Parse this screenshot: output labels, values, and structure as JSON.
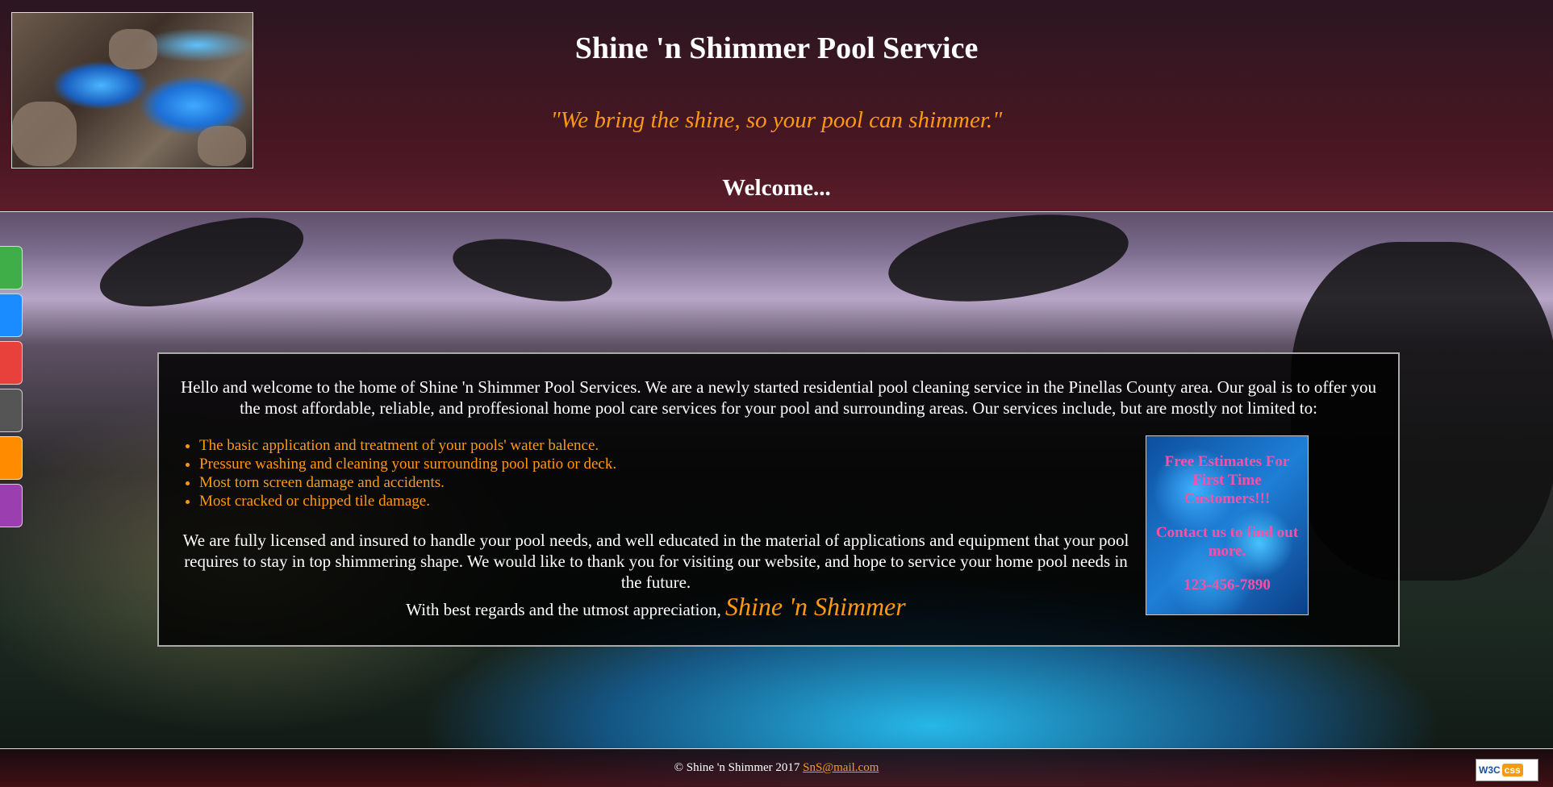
{
  "header": {
    "title": "Shine 'n Shimmer Pool Service",
    "tagline": "\"We bring the shine, so your pool can shimmer.\"",
    "welcome": "Welcome..."
  },
  "side_nav": {
    "colors": [
      "#3fae49",
      "#1a8cff",
      "#e8413c",
      "#555555",
      "#ff8c00",
      "#9b3fb0"
    ]
  },
  "main": {
    "intro": "Hello and welcome to the home of Shine 'n Shimmer Pool Services. We are a newly started residential pool cleaning service in the Pinellas County area. Our goal is to offer you the most affordable, reliable, and proffesional home pool care services for your pool and surrounding areas. Our services include, but are mostly not limited to:",
    "services": [
      "The basic application and treatment of your pools' water balence.",
      "Pressure washing and cleaning your surrounding pool patio or deck.",
      "Most torn screen damage and accidents.",
      "Most cracked or chipped tile damage."
    ],
    "closing": "We are fully licensed and insured to handle your pool needs, and well educated in the material of applications and equipment that your pool requires to stay in top shimmering shape. We would like to thank you for visiting our website, and hope to service your home pool needs in the future.",
    "regards": "With best regards and the utmost appreciation,",
    "signature": "Shine 'n Shimmer"
  },
  "promo": {
    "line1": "Free Estimates For First Time Customers!!!",
    "line2": "Contact us to find out more.",
    "phone": "123-456-7890"
  },
  "footer": {
    "copyright": "© Shine 'n Shimmer 2017",
    "email": "SnS@mail.com",
    "badge": "W3C css"
  },
  "colors": {
    "accent": "#ff9a10",
    "promo_text": "#ff4fa8"
  }
}
